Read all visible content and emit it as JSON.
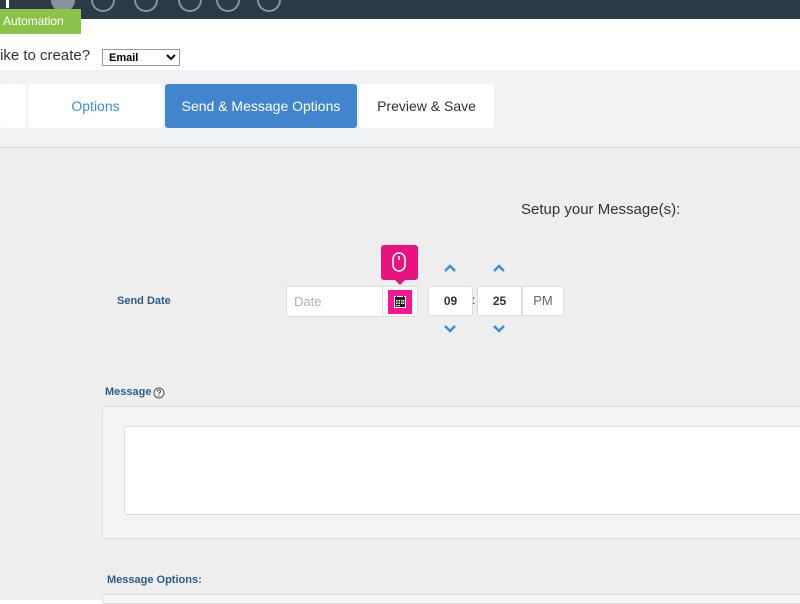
{
  "header": {
    "automation_label": "Automation",
    "create_prompt": "ike to create?",
    "message_type": {
      "selected": "Email",
      "options": [
        "Email"
      ]
    }
  },
  "tabs": [
    {
      "label": "Options",
      "active": false
    },
    {
      "label": "Send & Message Options",
      "active": true
    },
    {
      "label": "Preview & Save",
      "active": false
    }
  ],
  "setup": {
    "title": "Setup your Message(s):",
    "send_date": {
      "label": "Send Date",
      "placeholder": "Date",
      "hour": "09",
      "minute": "25",
      "separator": ":",
      "ampm": "PM"
    },
    "message": {
      "label": "Message",
      "value": ""
    },
    "message_options_label": "Message Options:"
  },
  "colors": {
    "accent_blue": "#4285cf",
    "label_blue": "#2a5d8c",
    "badge_green": "#8bc34a",
    "highlight_pink": "#e8137f",
    "topbar": "#2d3a48"
  },
  "icons": {
    "calendar": "calendar-icon",
    "mouse": "mouse-icon",
    "help": "help-icon",
    "up": "chevron-up-icon",
    "down": "chevron-down-icon"
  }
}
